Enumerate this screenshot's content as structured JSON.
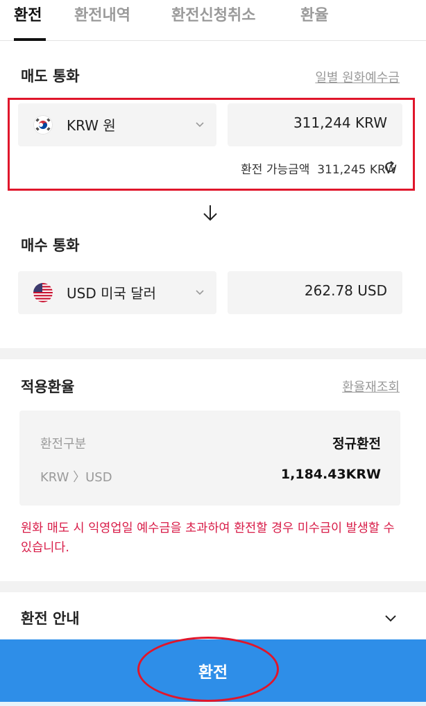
{
  "tabs": [
    {
      "label": "환전"
    },
    {
      "label": "환전내역"
    },
    {
      "label": "환전신청취소"
    },
    {
      "label": "환율"
    }
  ],
  "sell": {
    "title": "매도 통화",
    "link": "일별 원화예수금",
    "currency": "KRW 원",
    "amount": "311,244 KRW",
    "available_label": "환전 가능금액",
    "available_amount": "311,245 KRW"
  },
  "buy": {
    "title": "매수 통화",
    "currency": "USD 미국 달러",
    "amount": "262.78 USD"
  },
  "rate": {
    "title": "적용환율",
    "link": "환율재조회",
    "rows": [
      {
        "label": "환전구분",
        "value": "정규환전"
      },
      {
        "label": "KRW 〉USD",
        "value": "1,184.43KRW"
      }
    ]
  },
  "warning": "원화 매도 시 익영업일 예수금을 초과하여 환전할 경우 미수금이 발생할 수 있습니다.",
  "guide": {
    "title": "환전 안내"
  },
  "action": {
    "label": "환전"
  },
  "icons": {
    "korea_flag": "korea-flag-icon",
    "usa_flag": "usa-flag-icon",
    "chevron": "chevron-down-icon",
    "refresh": "refresh-icon",
    "arrow": "arrow-down-icon"
  },
  "colors": {
    "accent": "#2e8ee8",
    "warning": "#d81b47",
    "highlight": "#e0162b"
  }
}
